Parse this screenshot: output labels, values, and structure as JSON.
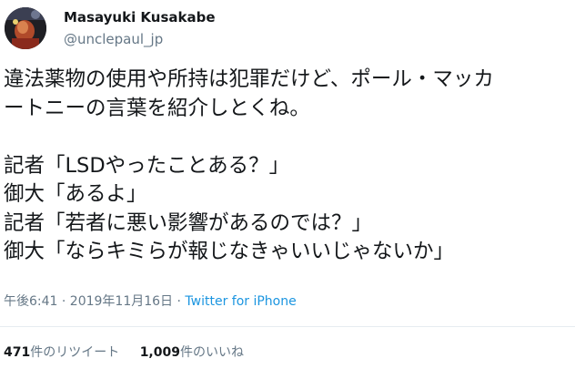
{
  "user": {
    "display_name": "Masayuki Kusakabe",
    "handle": "@unclepaul_jp"
  },
  "tweet": {
    "lines": [
      "違法薬物の使用や所持は犯罪だけど、ポール・マッカ",
      "ートニーの言葉を紹介しとくね。",
      "",
      "記者「LSDやったことある？」",
      "御大「あるよ」",
      "記者「若者に悪い影響があるのでは？」",
      "御大「ならキミらが報じなきゃいいじゃないか」"
    ],
    "timestamp": "午後6:41 · 2019年11月16日",
    "separator": " · ",
    "source": "Twitter for iPhone"
  },
  "stats": {
    "retweets_count": "471",
    "retweets_label": "件のリツイート",
    "likes_count": "1,009",
    "likes_label": "件のいいね"
  }
}
